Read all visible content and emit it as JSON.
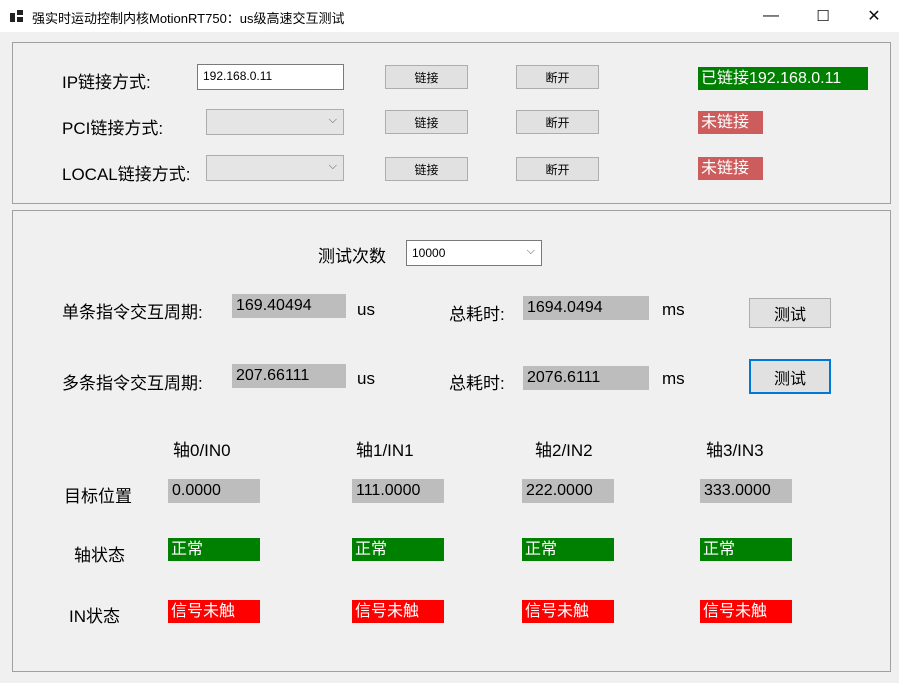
{
  "window": {
    "title": "强实时运动控制内核MotionRT750：us级高速交互测试",
    "minimize": "—",
    "maximize": "☐",
    "close": "✕"
  },
  "connection": {
    "ip": {
      "label": "IP链接方式:",
      "address": "192.168.0.11",
      "connect": "链接",
      "disconnect": "断开",
      "status": "已链接192.168.0.11"
    },
    "pci": {
      "label": "PCI链接方式:",
      "value": "",
      "connect": "链接",
      "disconnect": "断开",
      "status": "未链接"
    },
    "local": {
      "label": "LOCAL链接方式:",
      "value": "",
      "connect": "链接",
      "disconnect": "断开",
      "status": "未链接"
    }
  },
  "test": {
    "count_label": "测试次数",
    "count_value": "10000",
    "single": {
      "label": "单条指令交互周期:",
      "period": "169.40494",
      "period_unit": "us",
      "total_label": "总耗时:",
      "total": "1694.0494",
      "total_unit": "ms",
      "button": "测试"
    },
    "multi": {
      "label": "多条指令交互周期:",
      "period": "207.66111",
      "period_unit": "us",
      "total_label": "总耗时:",
      "total": "2076.6111",
      "total_unit": "ms",
      "button": "测试"
    }
  },
  "axes": {
    "headers": [
      "轴0/IN0",
      "轴1/IN1",
      "轴2/IN2",
      "轴3/IN3"
    ],
    "row_labels": {
      "target": "目标位置",
      "axis_state": "轴状态",
      "in_state": "IN状态"
    },
    "target": [
      "0.0000",
      "111.0000",
      "222.0000",
      "333.0000"
    ],
    "axis_state": [
      "正常",
      "正常",
      "正常",
      "正常"
    ],
    "in_state": [
      "信号未触",
      "信号未触",
      "信号未触",
      "信号未触"
    ]
  },
  "colors": {
    "connected": "#008000",
    "disconnected": "#cd5c5c",
    "signal": "#ff0000",
    "readonly": "#bdbdbd",
    "focus": "#0078d7"
  }
}
